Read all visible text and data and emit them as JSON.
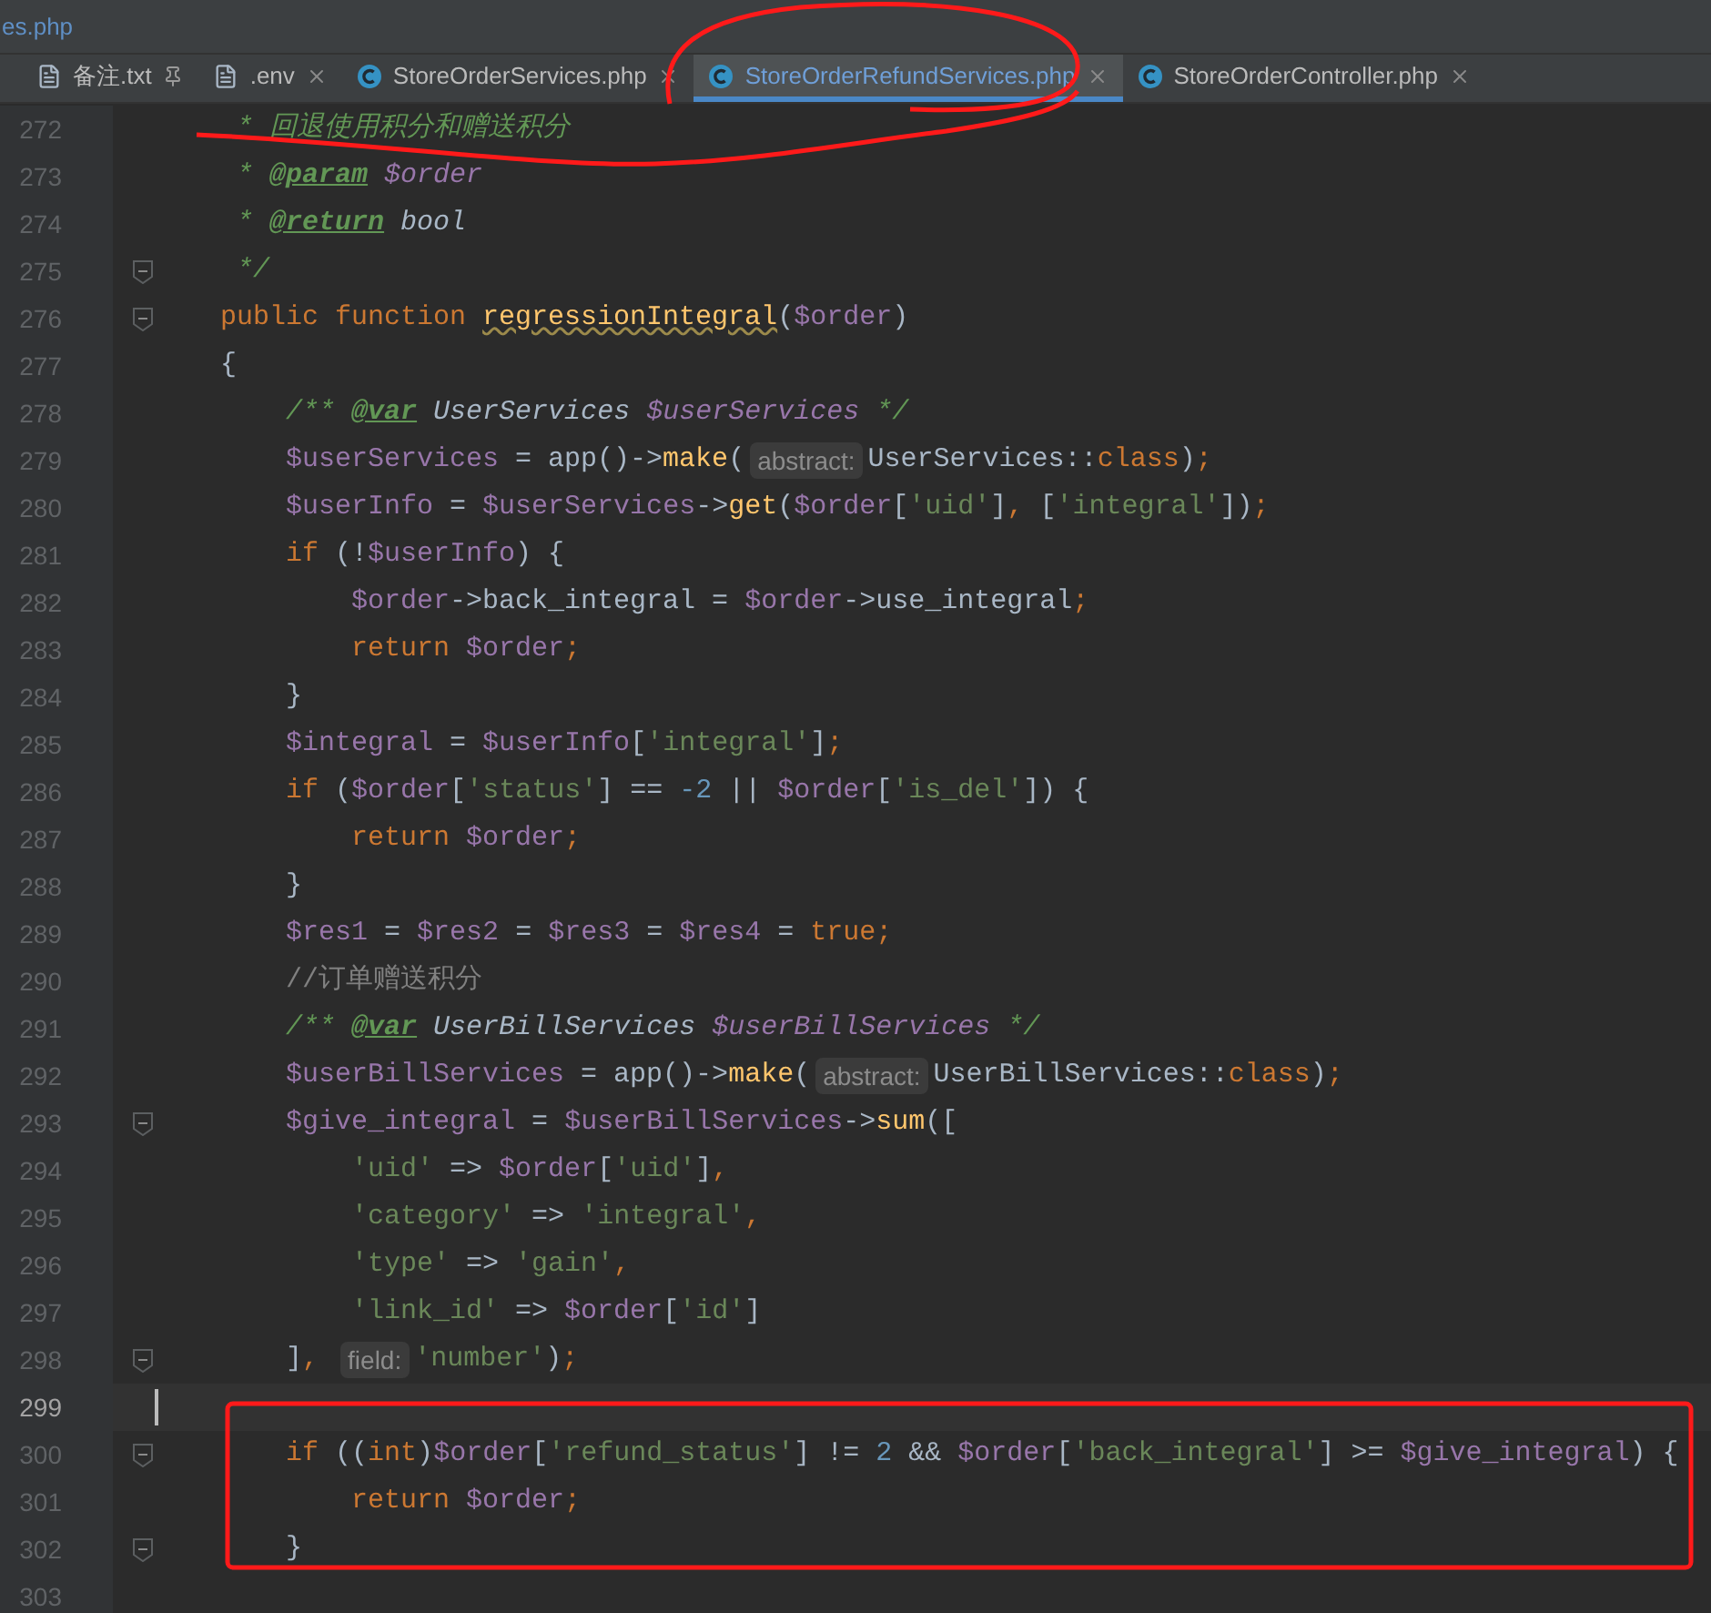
{
  "path_bar": {
    "text": "es.php"
  },
  "tabs": [
    {
      "label": "备注.txt",
      "kind": "file",
      "pinned": true,
      "selected": false
    },
    {
      "label": ".env",
      "kind": "file",
      "pinned": false,
      "selected": false
    },
    {
      "label": "StoreOrderServices.php",
      "kind": "class",
      "pinned": false,
      "selected": false
    },
    {
      "label": "StoreOrderRefundServices.php",
      "kind": "class",
      "pinned": false,
      "selected": true
    },
    {
      "label": "StoreOrderController.php",
      "kind": "class",
      "pinned": false,
      "selected": false
    }
  ],
  "lines": [
    {
      "number": "272",
      "fold": false,
      "current": false,
      "segments": [
        {
          "kind": "code",
          "tokens": [
            {
              "kind": "dc",
              "text": "     * 回退使用积分和赠送积分"
            }
          ]
        }
      ]
    },
    {
      "number": "273",
      "fold": false,
      "current": false,
      "segments": [
        {
          "kind": "code",
          "tokens": [
            {
              "kind": "dc",
              "text": "     * "
            },
            {
              "kind": "dt",
              "text": "@param"
            },
            {
              "kind": "dv",
              "text": " $order"
            }
          ]
        }
      ]
    },
    {
      "number": "274",
      "fold": false,
      "current": false,
      "segments": [
        {
          "kind": "code",
          "tokens": [
            {
              "kind": "dc",
              "text": "     * "
            },
            {
              "kind": "dt",
              "text": "@return"
            },
            {
              "kind": "di",
              "text": " bool"
            }
          ]
        }
      ]
    },
    {
      "number": "275",
      "fold": true,
      "current": false,
      "segments": [
        {
          "kind": "code",
          "tokens": [
            {
              "kind": "dc",
              "text": "     */"
            }
          ]
        }
      ]
    },
    {
      "number": "276",
      "fold": true,
      "current": false,
      "segments": [
        {
          "kind": "code",
          "tokens": [
            {
              "kind": "k",
              "text": "    public function "
            },
            {
              "kind": "fw",
              "text": "regressionIntegral"
            },
            {
              "kind": "p",
              "text": "("
            },
            {
              "kind": "v",
              "text": "$order"
            },
            {
              "kind": "p",
              "text": ")"
            }
          ]
        }
      ]
    },
    {
      "number": "277",
      "fold": false,
      "current": false,
      "segments": [
        {
          "kind": "code",
          "tokens": [
            {
              "kind": "p",
              "text": "    {"
            }
          ]
        }
      ]
    },
    {
      "number": "278",
      "fold": false,
      "current": false,
      "segments": [
        {
          "kind": "code",
          "tokens": [
            {
              "kind": "dc",
              "text": "        /** "
            },
            {
              "kind": "dt",
              "text": "@var"
            },
            {
              "kind": "di",
              "text": " UserServices"
            },
            {
              "kind": "dv",
              "text": " $userServices"
            },
            {
              "kind": "dc",
              "text": " */"
            }
          ]
        }
      ]
    },
    {
      "number": "279",
      "fold": false,
      "current": false,
      "segments": [
        {
          "kind": "code",
          "tokens": [
            {
              "kind": "v",
              "text": "        $userServices"
            },
            {
              "kind": "p",
              "text": " = app()->"
            },
            {
              "kind": "f",
              "text": "make"
            },
            {
              "kind": "p",
              "text": "("
            }
          ]
        },
        {
          "kind": "hint",
          "text": "abstract:"
        },
        {
          "kind": "code",
          "tokens": [
            {
              "kind": "p",
              "text": "UserServices::"
            },
            {
              "kind": "k",
              "text": "class"
            },
            {
              "kind": "p",
              "text": ")"
            },
            {
              "kind": "k",
              "text": ";"
            }
          ]
        }
      ]
    },
    {
      "number": "280",
      "fold": false,
      "current": false,
      "segments": [
        {
          "kind": "code",
          "tokens": [
            {
              "kind": "v",
              "text": "        $userInfo"
            },
            {
              "kind": "p",
              "text": " = "
            },
            {
              "kind": "v",
              "text": "$userServices"
            },
            {
              "kind": "p",
              "text": "->"
            },
            {
              "kind": "f",
              "text": "get"
            },
            {
              "kind": "p",
              "text": "("
            },
            {
              "kind": "v",
              "text": "$order"
            },
            {
              "kind": "p",
              "text": "["
            },
            {
              "kind": "s",
              "text": "'uid'"
            },
            {
              "kind": "p",
              "text": "]"
            },
            {
              "kind": "k",
              "text": ", "
            },
            {
              "kind": "p",
              "text": "["
            },
            {
              "kind": "s",
              "text": "'integral'"
            },
            {
              "kind": "p",
              "text": "])"
            },
            {
              "kind": "k",
              "text": ";"
            }
          ]
        }
      ]
    },
    {
      "number": "281",
      "fold": false,
      "current": false,
      "segments": [
        {
          "kind": "code",
          "tokens": [
            {
              "kind": "k",
              "text": "        if"
            },
            {
              "kind": "p",
              "text": " (!"
            },
            {
              "kind": "v",
              "text": "$userInfo"
            },
            {
              "kind": "p",
              "text": ") {"
            }
          ]
        }
      ]
    },
    {
      "number": "282",
      "fold": false,
      "current": false,
      "segments": [
        {
          "kind": "code",
          "tokens": [
            {
              "kind": "v",
              "text": "            $order"
            },
            {
              "kind": "p",
              "text": "->back_integral = "
            },
            {
              "kind": "v",
              "text": "$order"
            },
            {
              "kind": "p",
              "text": "->use_integral"
            },
            {
              "kind": "k",
              "text": ";"
            }
          ]
        }
      ]
    },
    {
      "number": "283",
      "fold": false,
      "current": false,
      "segments": [
        {
          "kind": "code",
          "tokens": [
            {
              "kind": "k",
              "text": "            return "
            },
            {
              "kind": "v",
              "text": "$order"
            },
            {
              "kind": "k",
              "text": ";"
            }
          ]
        }
      ]
    },
    {
      "number": "284",
      "fold": false,
      "current": false,
      "segments": [
        {
          "kind": "code",
          "tokens": [
            {
              "kind": "p",
              "text": "        }"
            }
          ]
        }
      ]
    },
    {
      "number": "285",
      "fold": false,
      "current": false,
      "segments": [
        {
          "kind": "code",
          "tokens": [
            {
              "kind": "v",
              "text": "        $integral"
            },
            {
              "kind": "p",
              "text": " = "
            },
            {
              "kind": "v",
              "text": "$userInfo"
            },
            {
              "kind": "p",
              "text": "["
            },
            {
              "kind": "s",
              "text": "'integral'"
            },
            {
              "kind": "p",
              "text": "]"
            },
            {
              "kind": "k",
              "text": ";"
            }
          ]
        }
      ]
    },
    {
      "number": "286",
      "fold": false,
      "current": false,
      "segments": [
        {
          "kind": "code",
          "tokens": [
            {
              "kind": "k",
              "text": "        if"
            },
            {
              "kind": "p",
              "text": " ("
            },
            {
              "kind": "v",
              "text": "$order"
            },
            {
              "kind": "p",
              "text": "["
            },
            {
              "kind": "s",
              "text": "'status'"
            },
            {
              "kind": "p",
              "text": "] == "
            },
            {
              "kind": "n",
              "text": "-2"
            },
            {
              "kind": "p",
              "text": " || "
            },
            {
              "kind": "v",
              "text": "$order"
            },
            {
              "kind": "p",
              "text": "["
            },
            {
              "kind": "s",
              "text": "'is_del'"
            },
            {
              "kind": "p",
              "text": "]) {"
            }
          ]
        }
      ]
    },
    {
      "number": "287",
      "fold": false,
      "current": false,
      "segments": [
        {
          "kind": "code",
          "tokens": [
            {
              "kind": "k",
              "text": "            return "
            },
            {
              "kind": "v",
              "text": "$order"
            },
            {
              "kind": "k",
              "text": ";"
            }
          ]
        }
      ]
    },
    {
      "number": "288",
      "fold": false,
      "current": false,
      "segments": [
        {
          "kind": "code",
          "tokens": [
            {
              "kind": "p",
              "text": "        }"
            }
          ]
        }
      ]
    },
    {
      "number": "289",
      "fold": false,
      "current": false,
      "segments": [
        {
          "kind": "code",
          "tokens": [
            {
              "kind": "v",
              "text": "        $res1"
            },
            {
              "kind": "p",
              "text": " = "
            },
            {
              "kind": "v",
              "text": "$res2"
            },
            {
              "kind": "p",
              "text": " = "
            },
            {
              "kind": "v",
              "text": "$res3"
            },
            {
              "kind": "p",
              "text": " = "
            },
            {
              "kind": "v",
              "text": "$res4"
            },
            {
              "kind": "p",
              "text": " = "
            },
            {
              "kind": "k",
              "text": "true;"
            }
          ]
        }
      ]
    },
    {
      "number": "290",
      "fold": false,
      "current": false,
      "segments": [
        {
          "kind": "code",
          "tokens": [
            {
              "kind": "lc",
              "text": "        //订单赠送积分"
            }
          ]
        }
      ]
    },
    {
      "number": "291",
      "fold": false,
      "current": false,
      "segments": [
        {
          "kind": "code",
          "tokens": [
            {
              "kind": "dc",
              "text": "        /** "
            },
            {
              "kind": "dt",
              "text": "@var"
            },
            {
              "kind": "di",
              "text": " UserBillServices"
            },
            {
              "kind": "dv",
              "text": " $userBillServices"
            },
            {
              "kind": "dc",
              "text": " */"
            }
          ]
        }
      ]
    },
    {
      "number": "292",
      "fold": false,
      "current": false,
      "segments": [
        {
          "kind": "code",
          "tokens": [
            {
              "kind": "v",
              "text": "        $userBillServices"
            },
            {
              "kind": "p",
              "text": " = app()->"
            },
            {
              "kind": "f",
              "text": "make"
            },
            {
              "kind": "p",
              "text": "("
            }
          ]
        },
        {
          "kind": "hint",
          "text": "abstract:"
        },
        {
          "kind": "code",
          "tokens": [
            {
              "kind": "p",
              "text": "UserBillServices::"
            },
            {
              "kind": "k",
              "text": "class"
            },
            {
              "kind": "p",
              "text": ")"
            },
            {
              "kind": "k",
              "text": ";"
            }
          ]
        }
      ]
    },
    {
      "number": "293",
      "fold": true,
      "current": false,
      "segments": [
        {
          "kind": "code",
          "tokens": [
            {
              "kind": "v",
              "text": "        $give_integral"
            },
            {
              "kind": "p",
              "text": " = "
            },
            {
              "kind": "v",
              "text": "$userBillServices"
            },
            {
              "kind": "p",
              "text": "->"
            },
            {
              "kind": "f",
              "text": "sum"
            },
            {
              "kind": "p",
              "text": "(["
            }
          ]
        }
      ]
    },
    {
      "number": "294",
      "fold": false,
      "current": false,
      "segments": [
        {
          "kind": "code",
          "tokens": [
            {
              "kind": "s",
              "text": "            'uid'"
            },
            {
              "kind": "p",
              "text": " => "
            },
            {
              "kind": "v",
              "text": "$order"
            },
            {
              "kind": "p",
              "text": "["
            },
            {
              "kind": "s",
              "text": "'uid'"
            },
            {
              "kind": "p",
              "text": "]"
            },
            {
              "kind": "k",
              "text": ","
            }
          ]
        }
      ]
    },
    {
      "number": "295",
      "fold": false,
      "current": false,
      "segments": [
        {
          "kind": "code",
          "tokens": [
            {
              "kind": "s",
              "text": "            'category'"
            },
            {
              "kind": "p",
              "text": " => "
            },
            {
              "kind": "s",
              "text": "'integral'"
            },
            {
              "kind": "k",
              "text": ","
            }
          ]
        }
      ]
    },
    {
      "number": "296",
      "fold": false,
      "current": false,
      "segments": [
        {
          "kind": "code",
          "tokens": [
            {
              "kind": "s",
              "text": "            'type'"
            },
            {
              "kind": "p",
              "text": " => "
            },
            {
              "kind": "s",
              "text": "'gain'"
            },
            {
              "kind": "k",
              "text": ","
            }
          ]
        }
      ]
    },
    {
      "number": "297",
      "fold": false,
      "current": false,
      "segments": [
        {
          "kind": "code",
          "tokens": [
            {
              "kind": "s",
              "text": "            'link_id'"
            },
            {
              "kind": "p",
              "text": " => "
            },
            {
              "kind": "v",
              "text": "$order"
            },
            {
              "kind": "p",
              "text": "["
            },
            {
              "kind": "s",
              "text": "'id'"
            },
            {
              "kind": "p",
              "text": "]"
            }
          ]
        }
      ]
    },
    {
      "number": "298",
      "fold": true,
      "current": false,
      "segments": [
        {
          "kind": "code",
          "tokens": [
            {
              "kind": "p",
              "text": "        ]"
            },
            {
              "kind": "k",
              "text": ", "
            }
          ]
        },
        {
          "kind": "hint",
          "text": "field:"
        },
        {
          "kind": "code",
          "tokens": [
            {
              "kind": "s",
              "text": "'number'"
            },
            {
              "kind": "p",
              "text": ")"
            },
            {
              "kind": "k",
              "text": ";"
            }
          ]
        }
      ]
    },
    {
      "number": "299",
      "fold": false,
      "current": true
    },
    {
      "number": "300",
      "fold": true,
      "current": false,
      "segments": [
        {
          "kind": "code",
          "tokens": [
            {
              "kind": "k",
              "text": "        if"
            },
            {
              "kind": "p",
              "text": " (("
            },
            {
              "kind": "k",
              "text": "int"
            },
            {
              "kind": "p",
              "text": ")"
            },
            {
              "kind": "v",
              "text": "$order"
            },
            {
              "kind": "p",
              "text": "["
            },
            {
              "kind": "s",
              "text": "'refund_status'"
            },
            {
              "kind": "p",
              "text": "] != "
            },
            {
              "kind": "n",
              "text": "2"
            },
            {
              "kind": "p",
              "text": " && "
            },
            {
              "kind": "v",
              "text": "$order"
            },
            {
              "kind": "p",
              "text": "["
            },
            {
              "kind": "s",
              "text": "'back_integral'"
            },
            {
              "kind": "p",
              "text": "] >= "
            },
            {
              "kind": "v",
              "text": "$give_integral"
            },
            {
              "kind": "p",
              "text": ") {"
            }
          ]
        }
      ]
    },
    {
      "number": "301",
      "fold": false,
      "current": false,
      "segments": [
        {
          "kind": "code",
          "tokens": [
            {
              "kind": "k",
              "text": "            return "
            },
            {
              "kind": "v",
              "text": "$order"
            },
            {
              "kind": "k",
              "text": ";"
            }
          ]
        }
      ]
    },
    {
      "number": "302",
      "fold": true,
      "current": false,
      "segments": [
        {
          "kind": "code",
          "tokens": [
            {
              "kind": "p",
              "text": "        }"
            }
          ]
        }
      ]
    },
    {
      "number": "303",
      "fold": false,
      "current": false
    }
  ]
}
